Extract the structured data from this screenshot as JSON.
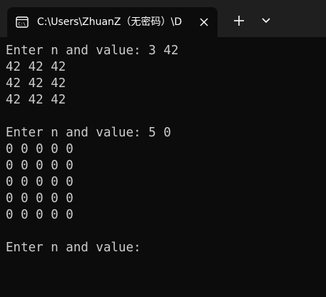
{
  "tab": {
    "title": "C:\\Users\\ZhuanZ（无密码）\\D",
    "icon": "terminal-icon",
    "close_icon": "close-icon"
  },
  "titlebar": {
    "new_tab_icon": "plus-icon",
    "dropdown_icon": "chevron-down-icon"
  },
  "console": {
    "lines": [
      "Enter n and value: 3 42",
      "42 42 42",
      "42 42 42",
      "42 42 42",
      "",
      "Enter n and value: 5 0",
      "0 0 0 0 0",
      "0 0 0 0 0",
      "0 0 0 0 0",
      "0 0 0 0 0",
      "0 0 0 0 0",
      "",
      "Enter n and value:"
    ]
  },
  "colors": {
    "titlebar_bg": "#1f1f1f",
    "console_bg": "#0c0c0c",
    "text": "#cccccc"
  }
}
